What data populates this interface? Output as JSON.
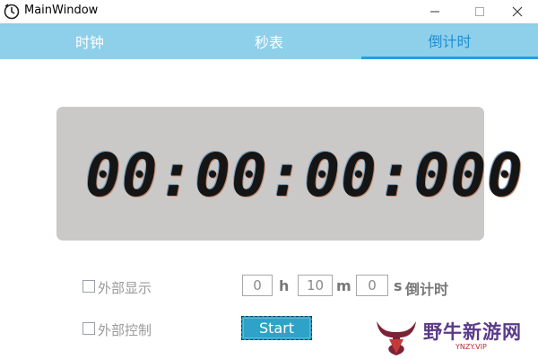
{
  "window": {
    "title": "MainWindow",
    "controls": {
      "minimize": "minimize-icon",
      "maximize": "maximize-icon",
      "close": "close-icon"
    }
  },
  "tabs": [
    {
      "label": "时钟",
      "selected": false
    },
    {
      "label": "秒表",
      "selected": false
    },
    {
      "label": "倒计时",
      "selected": true
    }
  ],
  "display": {
    "time": "00:00:00:000"
  },
  "options": {
    "external_display": {
      "label": "外部显示",
      "checked": false
    },
    "external_control": {
      "label": "外部控制",
      "checked": false
    }
  },
  "countdown": {
    "hours": "0",
    "hours_unit": "h",
    "minutes": "10",
    "minutes_unit": "m",
    "seconds": "0",
    "seconds_unit": "s",
    "label": "倒计时"
  },
  "start_button": {
    "label": "Start"
  },
  "watermark": {
    "text": "野牛新游网",
    "sub": "YNZY.VIP"
  },
  "colors": {
    "tab_bar": "#8ecfea",
    "tab_selected_text": "#1d8fd6",
    "display_bg": "#cbc9c7",
    "start_button": "#2fa2c7"
  }
}
